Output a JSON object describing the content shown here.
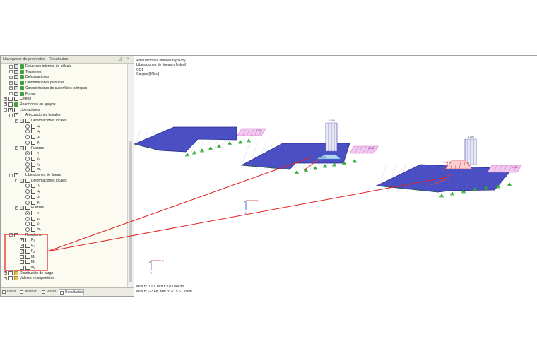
{
  "navigator": {
    "title": "Navegador de proyectos - Resultados",
    "controls": "◿ ×"
  },
  "tree": [
    {
      "indent": 1,
      "exp": "+",
      "chk": "grid",
      "icon": "grn",
      "label": "Esfuerzos internos de cálculo"
    },
    {
      "indent": 1,
      "exp": "+",
      "chk": "grid",
      "icon": "grn",
      "label": "Tensiones"
    },
    {
      "indent": 1,
      "exp": "+",
      "chk": "grid",
      "icon": "grn",
      "label": "Deformaciones"
    },
    {
      "indent": 1,
      "exp": "+",
      "chk": "grid",
      "icon": "grn",
      "label": "Deformaciones plásticas"
    },
    {
      "indent": 1,
      "exp": "+",
      "chk": "grid",
      "icon": "grn",
      "label": "Características de superficies isótropas"
    },
    {
      "indent": 1,
      "exp": "+",
      "chk": "grid",
      "icon": "grn",
      "label": "Forma"
    },
    {
      "indent": 0,
      "exp": "+",
      "chk": "box",
      "icon": "line",
      "label": "Criterio"
    },
    {
      "indent": 0,
      "exp": "+",
      "chk": "box",
      "icon": "grn",
      "label": "Reacciones en apoyos"
    },
    {
      "indent": 0,
      "exp": "-",
      "chk": "on",
      "icon": "line",
      "label": "Liberaciones"
    },
    {
      "indent": 1,
      "exp": "-",
      "chk": "on",
      "icon": "line",
      "label": "Articulaciones lineales"
    },
    {
      "indent": 2,
      "exp": "-",
      "chk": "grid",
      "icon": "line",
      "label": "Deformaciones locales"
    },
    {
      "indent": 3,
      "exp": "",
      "chk": "radio",
      "icon": "line",
      "label": "uₓ"
    },
    {
      "indent": 3,
      "exp": "",
      "chk": "radio",
      "icon": "line",
      "label": "uᵧ"
    },
    {
      "indent": 3,
      "exp": "",
      "chk": "radio",
      "icon": "line",
      "label": "uᵨ"
    },
    {
      "indent": 3,
      "exp": "",
      "chk": "radio",
      "icon": "line",
      "label": "φₓ"
    },
    {
      "indent": 2,
      "exp": "-",
      "chk": "grid",
      "icon": "line",
      "label": "Fuerzas"
    },
    {
      "indent": 3,
      "exp": "",
      "chk": "radio-on",
      "icon": "line",
      "label": "n"
    },
    {
      "indent": 3,
      "exp": "",
      "chk": "radio",
      "icon": "line",
      "label": "vᵧ"
    },
    {
      "indent": 3,
      "exp": "",
      "chk": "radio",
      "icon": "line",
      "label": "vᵨ"
    },
    {
      "indent": 3,
      "exp": "",
      "chk": "radio",
      "icon": "line",
      "label": "mₓ"
    },
    {
      "indent": 1,
      "exp": "-",
      "chk": "on",
      "icon": "line",
      "label": "Liberaciones de líneas"
    },
    {
      "indent": 2,
      "exp": "-",
      "chk": "grid",
      "icon": "line",
      "label": "Deformaciones locales"
    },
    {
      "indent": 3,
      "exp": "",
      "chk": "radio",
      "icon": "line",
      "label": "uₓ"
    },
    {
      "indent": 3,
      "exp": "",
      "chk": "radio",
      "icon": "line",
      "label": "uᵧ"
    },
    {
      "indent": 3,
      "exp": "",
      "chk": "radio",
      "icon": "line",
      "label": "uᵨ"
    },
    {
      "indent": 3,
      "exp": "",
      "chk": "radio",
      "icon": "line",
      "label": "φₓ"
    },
    {
      "indent": 2,
      "exp": "-",
      "chk": "grid",
      "icon": "line",
      "label": "Fuerzas"
    },
    {
      "indent": 3,
      "exp": "",
      "chk": "radio-on",
      "icon": "line",
      "label": "n"
    },
    {
      "indent": 3,
      "exp": "",
      "chk": "radio",
      "icon": "line",
      "label": "vᵧ"
    },
    {
      "indent": 3,
      "exp": "",
      "chk": "radio",
      "icon": "line",
      "label": "vᵨ"
    },
    {
      "indent": 3,
      "exp": "",
      "chk": "radio",
      "icon": "line",
      "label": "mₓ"
    },
    {
      "indent": 1,
      "exp": "-",
      "chk": "on",
      "icon": "line",
      "label": "Resultante"
    },
    {
      "indent": 2,
      "exp": "",
      "chk": "on",
      "icon": "line",
      "label": "Pₓ"
    },
    {
      "indent": 2,
      "exp": "",
      "chk": "on",
      "icon": "line",
      "label": "Pᵧ"
    },
    {
      "indent": 2,
      "exp": "",
      "chk": "on",
      "icon": "line",
      "label": "Pᵨ"
    },
    {
      "indent": 2,
      "exp": "",
      "chk": "box",
      "icon": "line",
      "label": "Mₓ"
    },
    {
      "indent": 2,
      "exp": "",
      "chk": "box",
      "icon": "line",
      "label": "Mᵧ"
    },
    {
      "indent": 2,
      "exp": "",
      "chk": "box",
      "icon": "line",
      "label": "Mᵨ"
    },
    {
      "indent": 0,
      "exp": "+",
      "chk": "box",
      "icon": "fold",
      "label": "Distribución de carga"
    },
    {
      "indent": 0,
      "exp": "+",
      "chk": "box",
      "icon": "fold",
      "label": "Valores en superficies"
    }
  ],
  "tabs": [
    {
      "label": "Datos"
    },
    {
      "label": "Mostrar"
    },
    {
      "label": "Vistas"
    },
    {
      "label": "Resultados"
    }
  ],
  "viewport": {
    "info": [
      "Articulaciones lineales n [kN/m]",
      "Liberaciones de líneas n [kN/m]",
      "CC1",
      "Cargas [kN/m]"
    ],
    "minmax": [
      "Máx n: 0.00, Mín n: 0.00 kN/m",
      "Máx n: -23.68, Mín n: -715.67 kN/m"
    ],
    "load_labels": [
      "5.000",
      "5.000",
      "5.000",
      "5.000",
      "5.000",
      "5.000"
    ],
    "result_labels": [
      "-23.68",
      "-715.67",
      "-715.67"
    ],
    "axis": {
      "x": "X",
      "z": "Z"
    }
  },
  "colors": {
    "plate": "#4a4fc4",
    "plate_edge": "#2a2d8a",
    "load": "#d070d0",
    "support": "#2ea82e",
    "result": "#e04040",
    "highlight": "#e02020"
  }
}
